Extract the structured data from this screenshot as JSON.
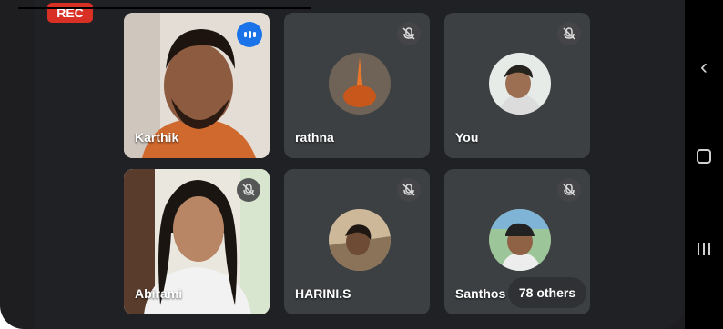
{
  "recording": {
    "label": "REC"
  },
  "participants": [
    {
      "name": "Karthik",
      "status": "speaking"
    },
    {
      "name": "rathna",
      "status": "muted"
    },
    {
      "name": "You",
      "status": "muted"
    },
    {
      "name": "Abirami",
      "status": "muted"
    },
    {
      "name": "HARINI.S",
      "status": "muted"
    },
    {
      "name": "Santhos",
      "status": "muted"
    }
  ],
  "overflow": {
    "label": "78 others"
  },
  "colors": {
    "background": "#202124",
    "tile": "#3c4043",
    "rec": "#d93025",
    "speaking": "#1a73e8"
  },
  "icons": [
    "mic-off-icon",
    "speaking-indicator-icon",
    "back-icon",
    "home-icon",
    "recents-icon"
  ]
}
